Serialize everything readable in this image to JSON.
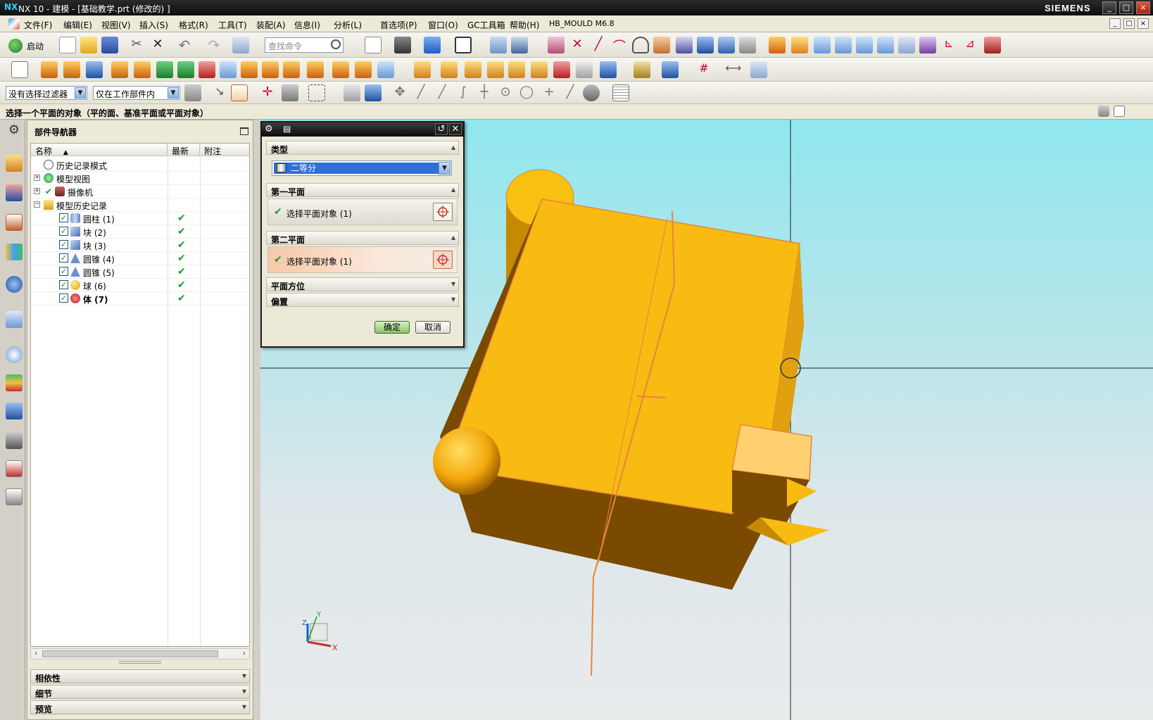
{
  "window": {
    "title": "NX 10 - 建模 - [基础教学.prt  (修改的) ]",
    "brand": "SIEMENS",
    "controls": [
      "_",
      "□",
      "×"
    ]
  },
  "menubar": {
    "items": [
      "文件(F)",
      "编辑(E)",
      "视图(V)",
      "插入(S)",
      "格式(R)",
      "工具(T)",
      "装配(A)",
      "信息(I)",
      "分析(L)",
      "首选项(P)",
      "窗口(O)",
      "GC工具箱",
      "帮助(H)",
      "HB_MOULD M6.8"
    ]
  },
  "toolbar": {
    "start_label": "启动",
    "search_placeholder": "查找命令",
    "selection_filter": "没有选择过滤器",
    "selection_scope": "仅在工作部件内"
  },
  "cue": "选择一个平面的对象（平的面、基准平面或平面对象）",
  "navigator": {
    "title": "部件导航器",
    "columns": [
      "名称",
      "最新",
      "附注"
    ],
    "rows": [
      {
        "label": "历史记录模式",
        "indent": 0,
        "expander": "",
        "checkbox": false,
        "latest": "",
        "icon": "clock"
      },
      {
        "label": "模型视图",
        "indent": 0,
        "expander": "+",
        "checkbox": false,
        "latest": "",
        "icon": "views"
      },
      {
        "label": "摄像机",
        "indent": 0,
        "expander": "+",
        "checkbox": false,
        "check_mark": "✔",
        "latest": "",
        "icon": "camera"
      },
      {
        "label": "模型历史记录",
        "indent": 0,
        "expander": "−",
        "checkbox": false,
        "latest": "",
        "icon": "folder"
      },
      {
        "label": "圆柱 (1)",
        "indent": 1,
        "expander": "",
        "checkbox": true,
        "latest": "✔",
        "icon": "cylinder"
      },
      {
        "label": "块 (2)",
        "indent": 1,
        "expander": "",
        "checkbox": true,
        "latest": "✔",
        "icon": "block"
      },
      {
        "label": "块 (3)",
        "indent": 1,
        "expander": "",
        "checkbox": true,
        "latest": "✔",
        "icon": "block"
      },
      {
        "label": "圆锥 (4)",
        "indent": 1,
        "expander": "",
        "checkbox": true,
        "latest": "✔",
        "icon": "cone"
      },
      {
        "label": "圆锥 (5)",
        "indent": 1,
        "expander": "",
        "checkbox": true,
        "latest": "✔",
        "icon": "cone"
      },
      {
        "label": "球 (6)",
        "indent": 1,
        "expander": "",
        "checkbox": true,
        "latest": "✔",
        "icon": "sphere"
      },
      {
        "label": "体 (7)",
        "indent": 1,
        "expander": "",
        "checkbox": true,
        "latest": "✔",
        "icon": "body",
        "bold": true
      }
    ],
    "panels": [
      "相依性",
      "细节",
      "预览"
    ]
  },
  "dialog": {
    "sections": {
      "type": "类型",
      "first_plane": "第一平面",
      "second_plane": "第二平面",
      "plane_orientation": "平面方位",
      "offset": "偏置"
    },
    "type_value": "二等分",
    "first_select": "选择平面对象 (1)",
    "second_select": "选择平面对象 (1)",
    "ok": "确定",
    "cancel": "取消"
  },
  "triad": {
    "x": "X",
    "y": "Y",
    "z": "Z"
  },
  "colors": {
    "viewport_top": "#8fe7ee",
    "viewport_bottom": "#e9ebec",
    "solid": "#f7bb12",
    "solid_dark": "#7a4a00",
    "highlight_edge": "#e8843a"
  }
}
